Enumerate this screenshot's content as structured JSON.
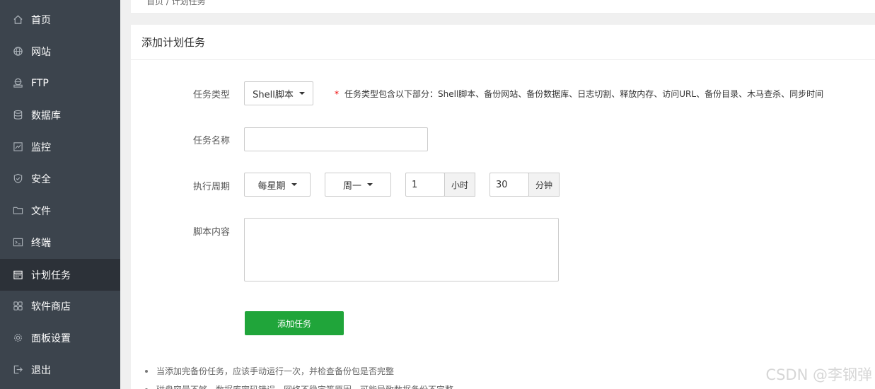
{
  "sidebar": {
    "items": [
      {
        "label": "首页",
        "icon": "home-icon"
      },
      {
        "label": "网站",
        "icon": "globe-icon"
      },
      {
        "label": "FTP",
        "icon": "ftp-icon"
      },
      {
        "label": "数据库",
        "icon": "database-icon"
      },
      {
        "label": "监控",
        "icon": "monitor-icon"
      },
      {
        "label": "安全",
        "icon": "shield-icon"
      },
      {
        "label": "文件",
        "icon": "folder-icon"
      },
      {
        "label": "终端",
        "icon": "terminal-icon"
      },
      {
        "label": "计划任务",
        "icon": "calendar-icon",
        "active": true
      },
      {
        "label": "软件商店",
        "icon": "apps-icon"
      },
      {
        "label": "面板设置",
        "icon": "gear-icon"
      },
      {
        "label": "退出",
        "icon": "logout-icon"
      }
    ]
  },
  "breadcrumb": "首页 / 计划任务",
  "panel": {
    "title": "添加计划任务",
    "task_type": {
      "label": "任务类型",
      "selected": "Shell脚本",
      "hint_star": "*",
      "hint": "任务类型包含以下部分：Shell脚本、备份网站、备份数据库、日志切割、释放内存、访问URL、备份目录、木马查杀、同步时间"
    },
    "task_name": {
      "label": "任务名称",
      "value": ""
    },
    "period": {
      "label": "执行周期",
      "cycle": "每星期",
      "weekday": "周一",
      "hour_value": "1",
      "hour_unit": "小时",
      "minute_value": "30",
      "minute_unit": "分钟"
    },
    "script": {
      "label": "脚本内容",
      "value": ""
    },
    "submit_label": "添加任务",
    "notes": [
      "当添加完备份任务，应该手动运行一次，并检查备份包是否完整",
      "磁盘容量不够、数据库密码错误、网络不稳定等原因，可能导致数据备份不完整"
    ]
  },
  "watermark": "CSDN @李钢弹",
  "colors": {
    "sidebar_bg": "#3c444d",
    "sidebar_active": "#2c3138",
    "primary": "#20a53a",
    "required": "#e00000"
  }
}
